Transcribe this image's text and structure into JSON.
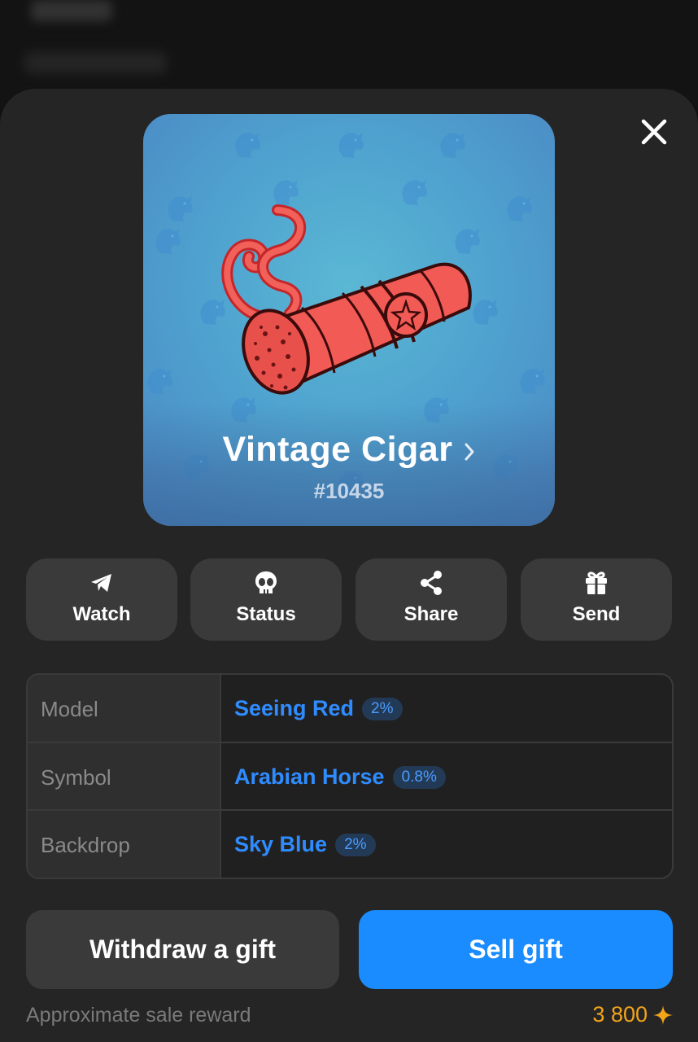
{
  "gift": {
    "title": "Vintage Cigar",
    "number": "#10435"
  },
  "actions": [
    {
      "label": "Watch",
      "icon": "telegram-plane-icon"
    },
    {
      "label": "Status",
      "icon": "skull-status-icon"
    },
    {
      "label": "Share",
      "icon": "share-icon"
    },
    {
      "label": "Send",
      "icon": "gift-icon"
    }
  ],
  "attributes": [
    {
      "key": "Model",
      "value": "Seeing Red",
      "rarity": "2%"
    },
    {
      "key": "Symbol",
      "value": "Arabian Horse",
      "rarity": "0.8%"
    },
    {
      "key": "Backdrop",
      "value": "Sky Blue",
      "rarity": "2%"
    }
  ],
  "buttons": {
    "withdraw": "Withdraw a gift",
    "sell": "Sell gift"
  },
  "footer": {
    "label": "Approximate sale reward",
    "amount": "3 800",
    "currency_icon": "star-icon"
  },
  "colors": {
    "accent": "#1a8cff",
    "link": "#2f8cff",
    "reward": "#f2a51b",
    "backdrop": "#4fa3cf",
    "model": "#f25a55"
  }
}
